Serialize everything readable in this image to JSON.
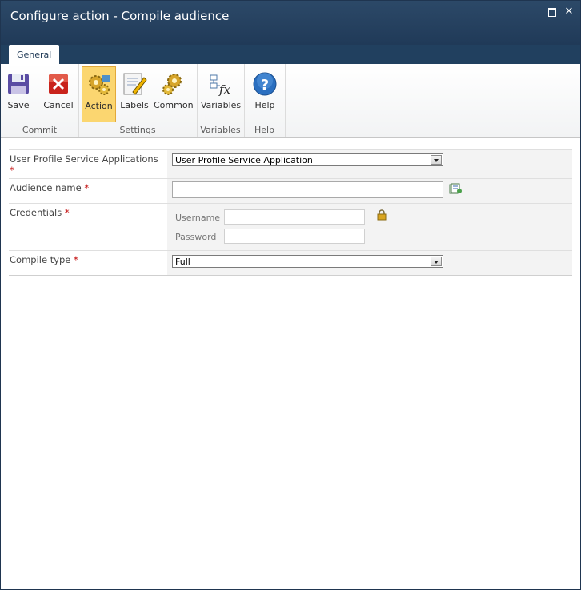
{
  "window": {
    "title": "Configure action - Compile audience"
  },
  "ribbon": {
    "tab": "General",
    "groups": [
      {
        "label": "Commit",
        "buttons": [
          "Save",
          "Cancel"
        ]
      },
      {
        "label": "Settings",
        "buttons": [
          "Action",
          "Labels",
          "Common"
        ]
      },
      {
        "label": "Variables",
        "buttons": [
          "Variables"
        ]
      },
      {
        "label": "Help",
        "buttons": [
          "Help"
        ]
      }
    ],
    "selected": "Action"
  },
  "form": {
    "ups_label": "User Profile Service Applications",
    "ups_value": "User Profile Service Application",
    "audience_label": "Audience name",
    "audience_value": "",
    "credentials_label": "Credentials",
    "username_label": "Username",
    "password_label": "Password",
    "compile_label": "Compile type",
    "compile_value": "Full",
    "required_mark": "*"
  },
  "colors": {
    "title_bar": "#203a58",
    "selected_button": "#fbd670",
    "required": "#c00000"
  }
}
